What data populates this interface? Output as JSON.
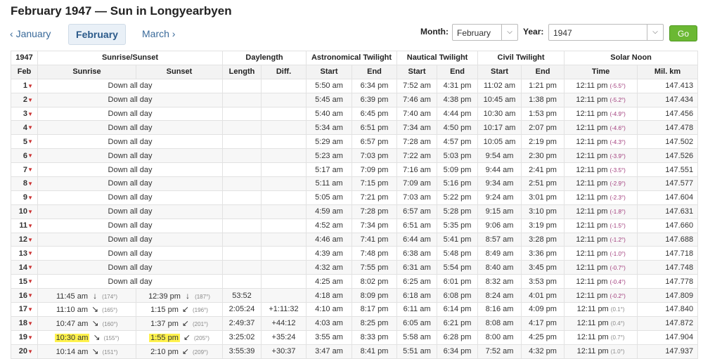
{
  "title": "February 1947 — Sun in Longyearbyen",
  "nav": {
    "prev": "January",
    "current": "February",
    "next": "March"
  },
  "controls": {
    "month_label": "Month:",
    "month_value": "February",
    "year_label": "Year:",
    "year_value": "1947",
    "go_label": "Go"
  },
  "header": {
    "year": "1947",
    "sunrise_sunset": "Sunrise/Sunset",
    "daylength": "Daylength",
    "astro": "Astronomical Twilight",
    "nautical": "Nautical Twilight",
    "civil": "Civil Twilight",
    "solar_noon": "Solar Noon",
    "feb": "Feb",
    "sunrise": "Sunrise",
    "sunset": "Sunset",
    "length": "Length",
    "diff": "Diff.",
    "start": "Start",
    "end": "End",
    "time": "Time",
    "milkm": "Mil. km"
  },
  "rows": [
    {
      "day": "1",
      "down": "Down all day",
      "as": "5:50 am",
      "ae": "6:34 pm",
      "ns": "7:52 am",
      "ne": "4:31 pm",
      "cs": "11:02 am",
      "ce": "1:21 pm",
      "noon": "12:11 pm",
      "noondeg": "(-5.5°)",
      "km": "147.413"
    },
    {
      "day": "2",
      "down": "Down all day",
      "as": "5:45 am",
      "ae": "6:39 pm",
      "ns": "7:46 am",
      "ne": "4:38 pm",
      "cs": "10:45 am",
      "ce": "1:38 pm",
      "noon": "12:11 pm",
      "noondeg": "(-5.2°)",
      "km": "147.434"
    },
    {
      "day": "3",
      "down": "Down all day",
      "as": "5:40 am",
      "ae": "6:45 pm",
      "ns": "7:40 am",
      "ne": "4:44 pm",
      "cs": "10:30 am",
      "ce": "1:53 pm",
      "noon": "12:11 pm",
      "noondeg": "(-4.9°)",
      "km": "147.456"
    },
    {
      "day": "4",
      "down": "Down all day",
      "as": "5:34 am",
      "ae": "6:51 pm",
      "ns": "7:34 am",
      "ne": "4:50 pm",
      "cs": "10:17 am",
      "ce": "2:07 pm",
      "noon": "12:11 pm",
      "noondeg": "(-4.6°)",
      "km": "147.478"
    },
    {
      "day": "5",
      "down": "Down all day",
      "as": "5:29 am",
      "ae": "6:57 pm",
      "ns": "7:28 am",
      "ne": "4:57 pm",
      "cs": "10:05 am",
      "ce": "2:19 pm",
      "noon": "12:11 pm",
      "noondeg": "(-4.3°)",
      "km": "147.502"
    },
    {
      "day": "6",
      "down": "Down all day",
      "as": "5:23 am",
      "ae": "7:03 pm",
      "ns": "7:22 am",
      "ne": "5:03 pm",
      "cs": "9:54 am",
      "ce": "2:30 pm",
      "noon": "12:11 pm",
      "noondeg": "(-3.9°)",
      "km": "147.526"
    },
    {
      "day": "7",
      "down": "Down all day",
      "as": "5:17 am",
      "ae": "7:09 pm",
      "ns": "7:16 am",
      "ne": "5:09 pm",
      "cs": "9:44 am",
      "ce": "2:41 pm",
      "noon": "12:11 pm",
      "noondeg": "(-3.5°)",
      "km": "147.551"
    },
    {
      "day": "8",
      "down": "Down all day",
      "as": "5:11 am",
      "ae": "7:15 pm",
      "ns": "7:09 am",
      "ne": "5:16 pm",
      "cs": "9:34 am",
      "ce": "2:51 pm",
      "noon": "12:11 pm",
      "noondeg": "(-2.9°)",
      "km": "147.577"
    },
    {
      "day": "9",
      "down": "Down all day",
      "as": "5:05 am",
      "ae": "7:21 pm",
      "ns": "7:03 am",
      "ne": "5:22 pm",
      "cs": "9:24 am",
      "ce": "3:01 pm",
      "noon": "12:11 pm",
      "noondeg": "(-2.3°)",
      "km": "147.604"
    },
    {
      "day": "10",
      "down": "Down all day",
      "as": "4:59 am",
      "ae": "7:28 pm",
      "ns": "6:57 am",
      "ne": "5:28 pm",
      "cs": "9:15 am",
      "ce": "3:10 pm",
      "noon": "12:11 pm",
      "noondeg": "(-1.8°)",
      "km": "147.631"
    },
    {
      "day": "11",
      "down": "Down all day",
      "as": "4:52 am",
      "ae": "7:34 pm",
      "ns": "6:51 am",
      "ne": "5:35 pm",
      "cs": "9:06 am",
      "ce": "3:19 pm",
      "noon": "12:11 pm",
      "noondeg": "(-1.5°)",
      "km": "147.660"
    },
    {
      "day": "12",
      "down": "Down all day",
      "as": "4:46 am",
      "ae": "7:41 pm",
      "ns": "6:44 am",
      "ne": "5:41 pm",
      "cs": "8:57 am",
      "ce": "3:28 pm",
      "noon": "12:11 pm",
      "noondeg": "(-1.2°)",
      "km": "147.688"
    },
    {
      "day": "13",
      "down": "Down all day",
      "as": "4:39 am",
      "ae": "7:48 pm",
      "ns": "6:38 am",
      "ne": "5:48 pm",
      "cs": "8:49 am",
      "ce": "3:36 pm",
      "noon": "12:11 pm",
      "noondeg": "(-1.0°)",
      "km": "147.718"
    },
    {
      "day": "14",
      "down": "Down all day",
      "as": "4:32 am",
      "ae": "7:55 pm",
      "ns": "6:31 am",
      "ne": "5:54 pm",
      "cs": "8:40 am",
      "ce": "3:45 pm",
      "noon": "12:11 pm",
      "noondeg": "(-0.7°)",
      "km": "147.748"
    },
    {
      "day": "15",
      "down": "Down all day",
      "as": "4:25 am",
      "ae": "8:02 pm",
      "ns": "6:25 am",
      "ne": "6:01 pm",
      "cs": "8:32 am",
      "ce": "3:53 pm",
      "noon": "12:11 pm",
      "noondeg": "(-0.4°)",
      "km": "147.778"
    },
    {
      "day": "16",
      "rise": "11:45 am",
      "riseArrow": "↓",
      "riseDeg": "(174°)",
      "set": "12:39 pm",
      "setArrow": "↓",
      "setDeg": "(187°)",
      "len": "53:52",
      "diff": "",
      "as": "4:18 am",
      "ae": "8:09 pm",
      "ns": "6:18 am",
      "ne": "6:08 pm",
      "cs": "8:24 am",
      "ce": "4:01 pm",
      "noon": "12:11 pm",
      "noondeg": "(-0.2°)",
      "km": "147.809"
    },
    {
      "day": "17",
      "rise": "11:10 am",
      "riseArrow": "↘",
      "riseDeg": "(165°)",
      "set": "1:15 pm",
      "setArrow": "↙",
      "setDeg": "(196°)",
      "len": "2:05:24",
      "diff": "+1:11:32",
      "as": "4:10 am",
      "ae": "8:17 pm",
      "ns": "6:11 am",
      "ne": "6:14 pm",
      "cs": "8:16 am",
      "ce": "4:09 pm",
      "noon": "12:11 pm",
      "noondeg": "(0.1°)",
      "km": "147.840"
    },
    {
      "day": "18",
      "rise": "10:47 am",
      "riseArrow": "↘",
      "riseDeg": "(160°)",
      "set": "1:37 pm",
      "setArrow": "↙",
      "setDeg": "(201°)",
      "len": "2:49:37",
      "diff": "+44:12",
      "as": "4:03 am",
      "ae": "8:25 pm",
      "ns": "6:05 am",
      "ne": "6:21 pm",
      "cs": "8:08 am",
      "ce": "4:17 pm",
      "noon": "12:11 pm",
      "noondeg": "(0.4°)",
      "km": "147.872"
    },
    {
      "day": "19",
      "rise": "10:30 am",
      "riseArrow": "↘",
      "riseDeg": "(155°)",
      "set": "1:55 pm",
      "setArrow": "↙",
      "setDeg": "(205°)",
      "len": "3:25:02",
      "diff": "+35:24",
      "as": "3:55 am",
      "ae": "8:33 pm",
      "ns": "5:58 am",
      "ne": "6:28 pm",
      "cs": "8:00 am",
      "ce": "4:25 pm",
      "noon": "12:11 pm",
      "noondeg": "(0.7°)",
      "km": "147.904",
      "highlight": true
    },
    {
      "day": "20",
      "rise": "10:14 am",
      "riseArrow": "↘",
      "riseDeg": "(151°)",
      "set": "2:10 pm",
      "setArrow": "↙",
      "setDeg": "(209°)",
      "len": "3:55:39",
      "diff": "+30:37",
      "as": "3:47 am",
      "ae": "8:41 pm",
      "ns": "5:51 am",
      "ne": "6:34 pm",
      "cs": "7:52 am",
      "ce": "4:32 pm",
      "noon": "12:11 pm",
      "noondeg": "(1.0°)",
      "km": "147.937"
    }
  ],
  "colors": {
    "link": "#3a6a9a",
    "go": "#6bb833",
    "highlight": "#fff24d",
    "dayArrow": "#c33"
  }
}
